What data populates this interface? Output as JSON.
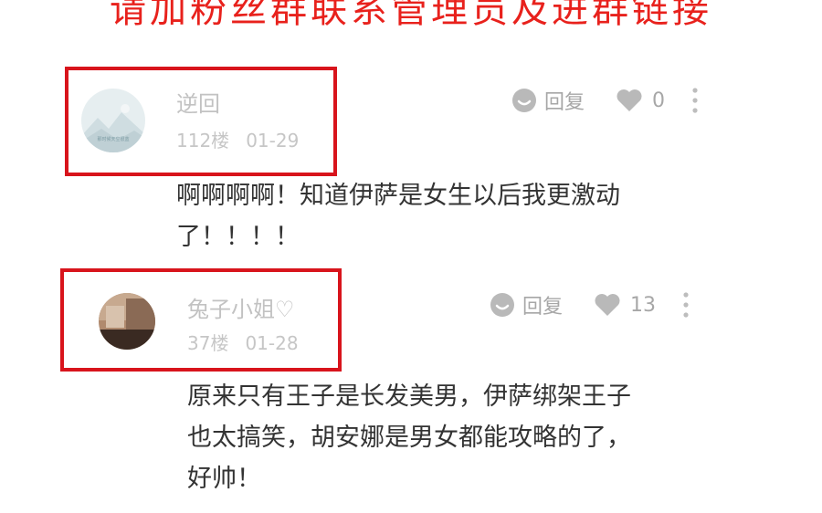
{
  "banner": {
    "text": "请加粉丝群联系管理员及进群链接"
  },
  "comments": [
    {
      "username": "逆回",
      "floor": "112楼",
      "date": "01-29",
      "reply_label": "回复",
      "like_count": "0",
      "text_lines": [
        "啊啊啊啊！知道伊萨是女生以后我更激动",
        "了！！！！"
      ],
      "avatar_icon": "landscape-avatar",
      "avatar_text": "那时候天空很蓝"
    },
    {
      "username": "兔子小姐♡",
      "floor": "37楼",
      "date": "01-28",
      "reply_label": "回复",
      "like_count": "13",
      "text_lines": [
        "原来只有王子是长发美男，伊萨绑架王子",
        "也太搞笑，胡安娜是男女都能攻略的了，",
        "好帅！"
      ],
      "avatar_icon": "photo-avatar"
    }
  ],
  "colors": {
    "highlight": "#d8141c",
    "banner": "#e8211c",
    "muted": "#c2c2c2",
    "body_text": "#333333"
  }
}
